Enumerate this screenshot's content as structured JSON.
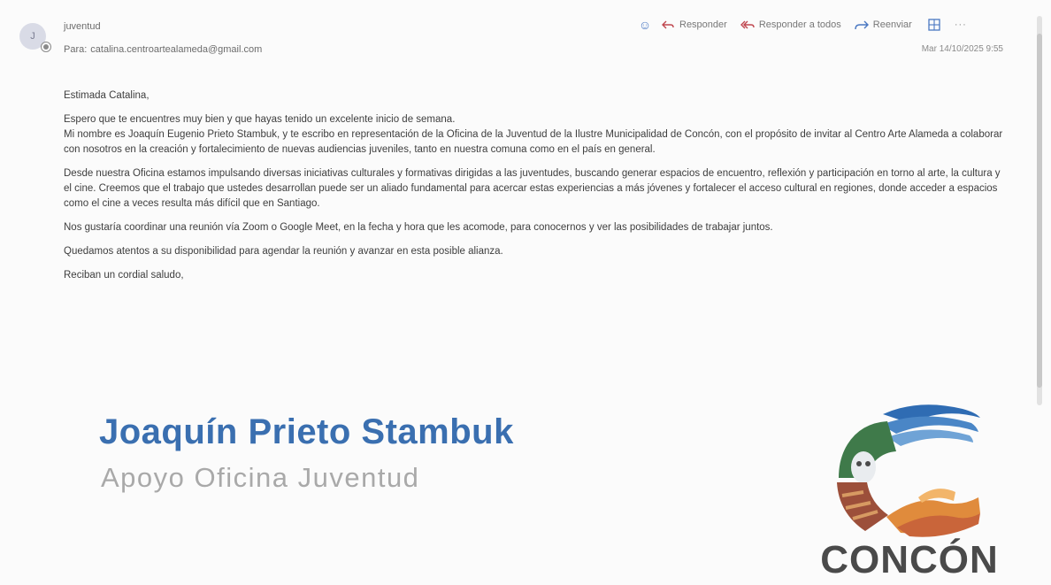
{
  "header": {
    "avatar_initial": "J",
    "sender": "juventud",
    "to_label": "Para:",
    "to_address": "catalina.centroartealameda@gmail.com",
    "date": "Mar 14/10/2025 9:55"
  },
  "actions": {
    "reply": "Responder",
    "reply_all": "Responder a todos",
    "forward": "Reenviar",
    "more": "···"
  },
  "body": {
    "greeting": "Estimada Catalina,",
    "p1_line1": "Espero que te encuentres muy bien y que hayas tenido un excelente inicio de semana.",
    "p1_line2": "Mi nombre es Joaquín Eugenio Prieto Stambuk, y te escribo en representación de la Oficina de la Juventud de la Ilustre Municipalidad de Concón, con el propósito de invitar al Centro Arte Alameda a colaborar con nosotros en la creación y fortalecimiento de nuevas audiencias juveniles, tanto en nuestra comuna como en el país en general.",
    "p2": "Desde nuestra Oficina estamos impulsando diversas iniciativas culturales y formativas dirigidas a las juventudes, buscando generar espacios de encuentro, reflexión y participación en torno al arte, la cultura y el cine. Creemos que el trabajo que ustedes desarrollan puede ser un aliado fundamental para acercar estas experiencias a más jóvenes y fortalecer el acceso cultural en regiones, donde acceder a espacios como el cine a veces resulta más difícil que en Santiago.",
    "p3": "Nos gustaría coordinar una reunión vía Zoom o Google Meet, en la fecha y hora que les acomode, para conocernos y ver las posibilidades de trabajar juntos.",
    "p4": "Quedamos atentos a su disponibilidad para agendar la reunión y avanzar en esta posible alianza.",
    "closing": "Reciban un cordial saludo,"
  },
  "signature": {
    "name": "Joaquín Prieto Stambuk",
    "role": "Apoyo Oficina Juventud",
    "logo_text": "CONCÓN"
  },
  "colors": {
    "signature_blue": "#3a6fb0",
    "action_red": "#c0474f",
    "action_blue": "#4a78c2"
  }
}
